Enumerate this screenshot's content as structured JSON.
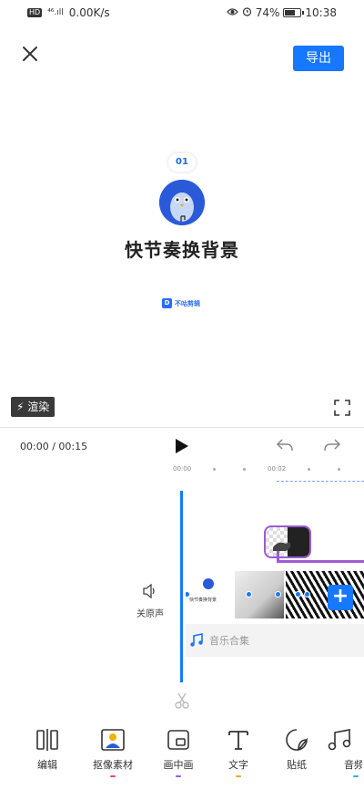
{
  "status_bar": {
    "hd": "HD",
    "signal": "⁴⁶.ıll",
    "network_speed": "0.00K/s",
    "battery_percent": "74%",
    "battery_level": 0.74,
    "time": "10:38"
  },
  "header": {
    "export_label": "导出"
  },
  "preview": {
    "chip_label": "01",
    "title": "快节奏换背景",
    "brand_text": "不咕剪辑"
  },
  "controls": {
    "render_label": "渲染",
    "time_readout": "00:00 / 00:15"
  },
  "timeline": {
    "ruler_ticks": [
      "00:00",
      "00:02"
    ],
    "mute_label": "关原声",
    "title_frame_text": "快节奏换背景",
    "music_label": "音乐合集"
  },
  "toolbar": {
    "items": [
      {
        "label": "编辑",
        "icon": "split-bars-icon",
        "underline": ""
      },
      {
        "label": "抠像素材",
        "icon": "portrait-cutout-icon",
        "underline": "#e8438a"
      },
      {
        "label": "画中画",
        "icon": "picture-in-picture-icon",
        "underline": "#8a5ee8"
      },
      {
        "label": "文字",
        "icon": "text-t-icon",
        "underline": "#f5a623"
      },
      {
        "label": "贴纸",
        "icon": "sticker-icon",
        "underline": ""
      },
      {
        "label": "音频",
        "icon": "music-note-icon",
        "underline": "#2ab7ca"
      }
    ]
  },
  "colors": {
    "accent": "#1677ff",
    "sticker_track": "#9b5bd6"
  }
}
